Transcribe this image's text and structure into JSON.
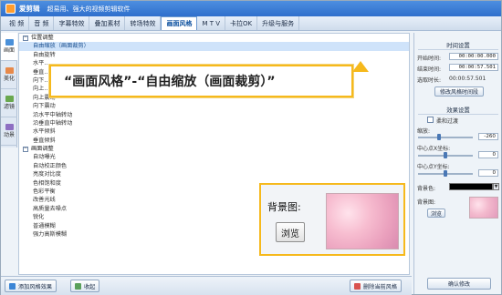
{
  "app": {
    "name": "爱剪辑",
    "slogan": "超易用、强大的视频剪辑软件"
  },
  "menu": [
    {
      "label": "视 频",
      "active": false
    },
    {
      "label": "音 频",
      "active": false
    },
    {
      "label": "字幕特效",
      "active": false
    },
    {
      "label": "叠加素材",
      "active": false
    },
    {
      "label": "转场特效",
      "active": false
    },
    {
      "label": "画面风格",
      "active": true
    },
    {
      "label": "M T V",
      "active": false
    },
    {
      "label": "卡拉OK",
      "active": false
    },
    {
      "label": "升级与服务",
      "active": false
    }
  ],
  "vtabs": [
    {
      "label": "画面",
      "icon": "picture-icon",
      "color": "#4a90d9",
      "active": true
    },
    {
      "label": "美化",
      "icon": "brush-icon",
      "color": "#e7894a",
      "active": false
    },
    {
      "label": "滤镜",
      "icon": "filter-icon",
      "color": "#6aa84f",
      "active": false
    },
    {
      "label": "动景",
      "icon": "motion-icon",
      "color": "#8e6fc2",
      "active": false
    }
  ],
  "list": {
    "groups": [
      {
        "title": "位置调整",
        "items": [
          {
            "label": "自由缩放（画面裁剪）",
            "selected": true
          },
          {
            "label": "自由旋转",
            "selected": false
          },
          {
            "label": "水平…",
            "selected": false
          },
          {
            "label": "垂直…",
            "selected": false
          },
          {
            "label": "向下…",
            "selected": false
          },
          {
            "label": "向上…",
            "selected": false
          },
          {
            "label": "向上震动",
            "selected": false
          },
          {
            "label": "向下震动",
            "selected": false
          },
          {
            "label": "沿水平中轴转动",
            "selected": false
          },
          {
            "label": "沿垂直中轴转动",
            "selected": false
          },
          {
            "label": "水平倾斜",
            "selected": false
          },
          {
            "label": "垂直倾斜",
            "selected": false
          }
        ]
      },
      {
        "title": "画面调整",
        "items": [
          {
            "label": "自动曝光",
            "selected": false
          },
          {
            "label": "自动校正颜色",
            "selected": false
          },
          {
            "label": "亮度对比度",
            "selected": false
          },
          {
            "label": "色相饱和度",
            "selected": false
          },
          {
            "label": "色彩平衡",
            "selected": false
          },
          {
            "label": "改善光线",
            "selected": false
          },
          {
            "label": "高质量去噪点",
            "selected": false
          },
          {
            "label": "锐化",
            "selected": false
          },
          {
            "label": "普通模糊",
            "selected": false
          },
          {
            "label": "强力高斯模糊",
            "selected": false
          }
        ]
      }
    ]
  },
  "callout": {
    "text": "“画面风格”-“自由缩放（画面裁剪）”"
  },
  "background_box": {
    "label": "背景图:",
    "browse_label": "浏览"
  },
  "right_panel": {
    "time_settings": {
      "title": "时间设置",
      "start_label": "开始时间:",
      "start_value": "00:00:00.000",
      "end_label": "结束时间:",
      "end_value": "00:00:57.501",
      "duration_label": "选取时长:",
      "duration_value": "00:00:57.501",
      "modify_button": "修改风格时间段"
    },
    "effect_settings": {
      "title": "效果设置",
      "soft_transition_label": "柔和过渡",
      "soft_transition_checked": false,
      "zoom_label": "缩放:",
      "zoom_value": "-260",
      "zoom_level": 0.38,
      "center_x_label": "中心点X坐标:",
      "center_x_value": "0",
      "center_x_level": 0.5,
      "center_y_label": "中心点Y坐标:",
      "center_y_value": "0",
      "center_y_level": 0.5,
      "bg_color_label": "背景色:",
      "bg_color": "#000000",
      "bg_image_label": "背景图:",
      "browse_label": "浏览"
    },
    "confirm_button": "确认修改"
  },
  "bottom_bar": {
    "add_button": "添加风格效果",
    "collect_button": "收起",
    "delete_button": "删除当前风格"
  },
  "colors": {
    "accent": "#2f6fcc",
    "highlight": "#f6b91c",
    "selected_row": "#cfe3fa"
  }
}
